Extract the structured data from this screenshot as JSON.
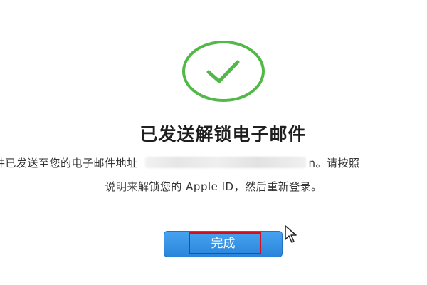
{
  "header": {
    "icon": "checkmark-circle-icon",
    "accent_color": "#52b847"
  },
  "main": {
    "title": "已发送解锁电子邮件",
    "description_line1_before": "件已发送至您的电子邮件地址",
    "description_line1_redacted_tail": "n",
    "description_line1_after": "。请按照",
    "description_line2": "说明来解锁您的 Apple ID，然后重新登录。"
  },
  "actions": {
    "done_label": "完成",
    "done_color": "#2f8ee5"
  },
  "overlay": {
    "highlight_color": "#d40f1c",
    "cursor": "mouse-pointer-icon"
  }
}
